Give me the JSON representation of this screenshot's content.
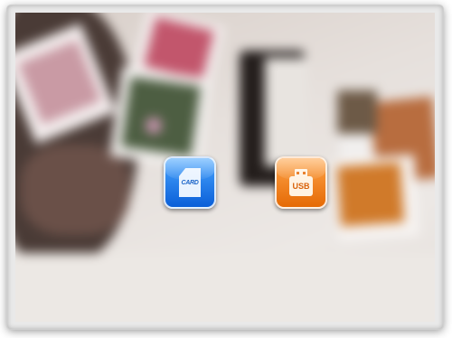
{
  "screen": {
    "background": "blurred-photo-collage"
  },
  "sources": {
    "card": {
      "icon": "sd-card-icon",
      "label": "CARD",
      "color": "#1a74e8"
    },
    "usb": {
      "icon": "usb-drive-icon",
      "label": "USB",
      "color": "#f07d12"
    }
  }
}
